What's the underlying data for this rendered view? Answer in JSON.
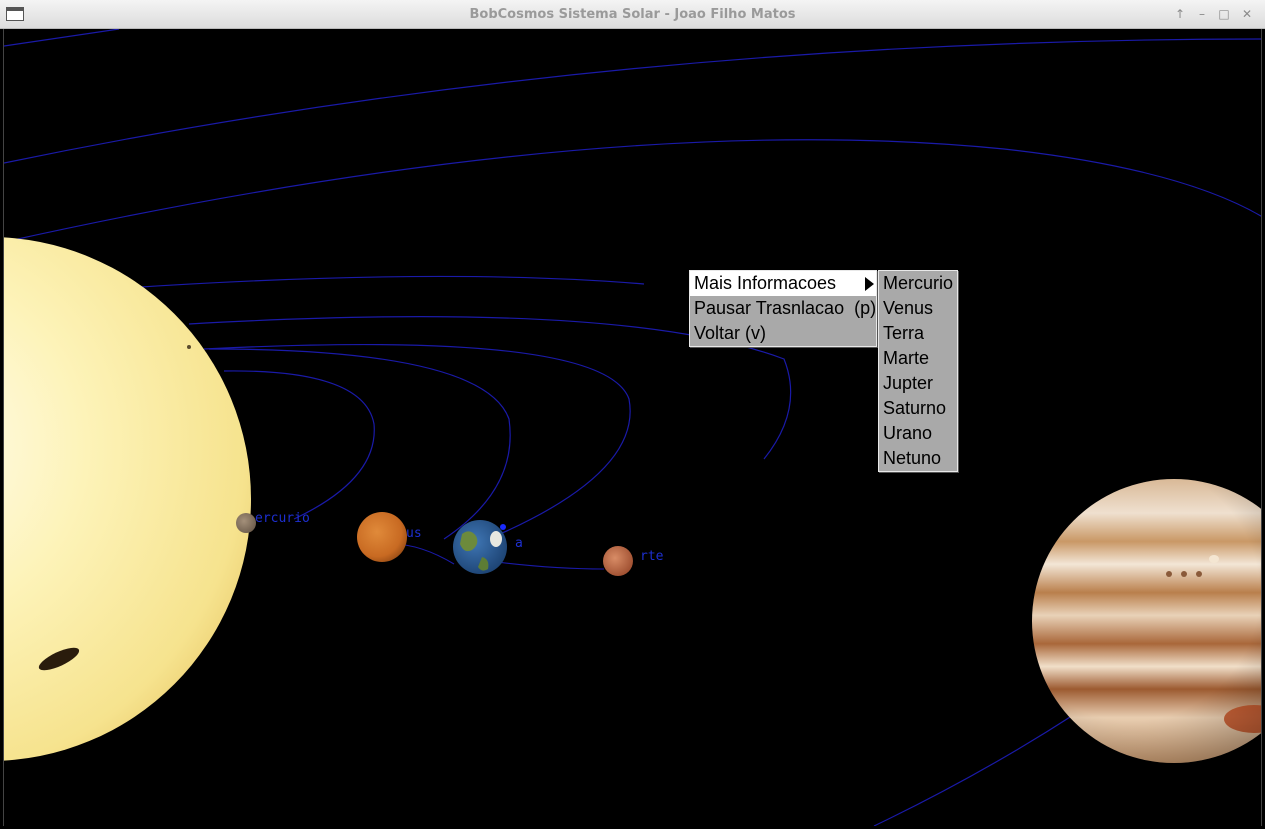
{
  "window": {
    "title": "BobCosmos Sistema Solar - Joao Filho Matos",
    "controls": {
      "pin": "↑",
      "minimize": "–",
      "maximize": "□",
      "close": "✕"
    }
  },
  "scene": {
    "background": "#000000",
    "orbit_color": "#1a1aa8",
    "label_color": "#1d2fd0",
    "labels": {
      "mercurio": "ercurio",
      "venus": "us",
      "terra": "a",
      "marte": "rte"
    }
  },
  "context_menu": {
    "items": [
      {
        "label": "Mais Informacoes",
        "has_submenu": true,
        "active": true
      },
      {
        "label": "Pausar Trasnlacao  (p)"
      },
      {
        "label": "Voltar (v)"
      }
    ]
  },
  "submenu": {
    "items": [
      "Mercurio",
      "Venus",
      "Terra",
      "Marte",
      "Jupter",
      "Saturno",
      "Urano",
      "Netuno"
    ]
  }
}
